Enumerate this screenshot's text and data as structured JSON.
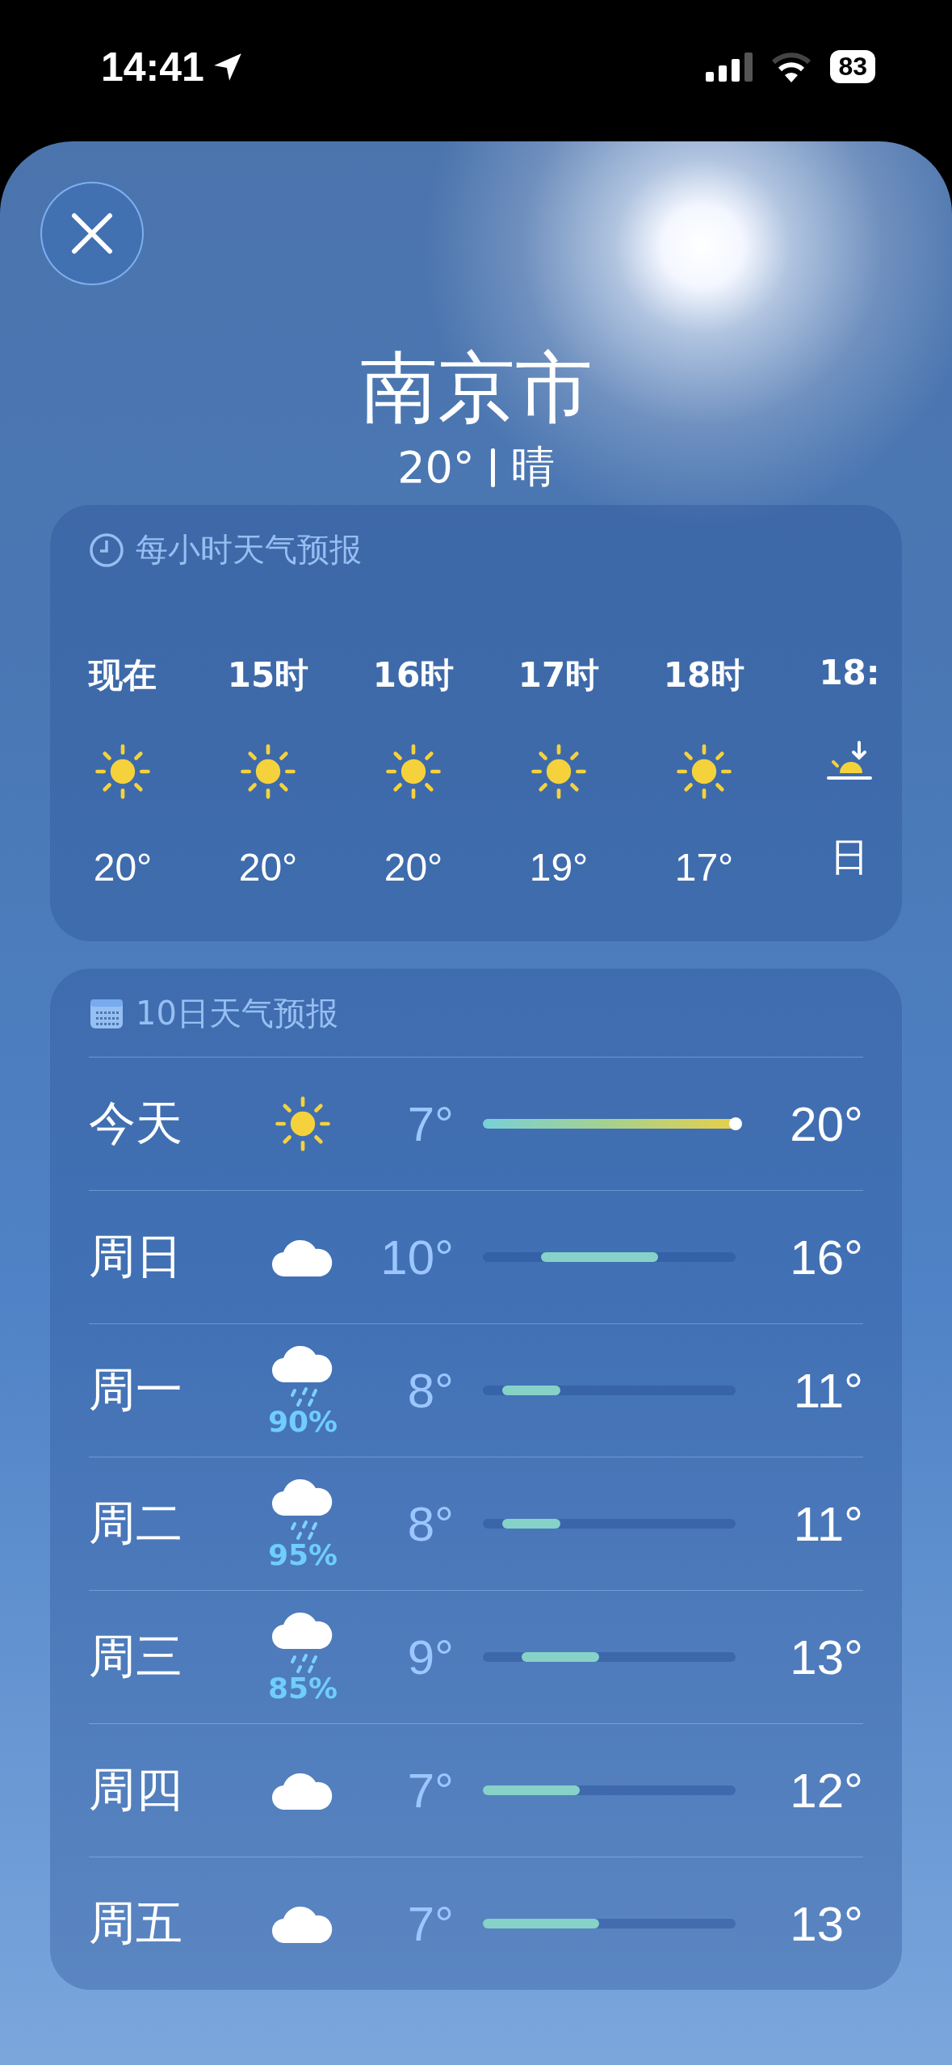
{
  "status_bar": {
    "time": "14:41",
    "battery": "83"
  },
  "header": {
    "city": "南京市",
    "temperature": "20°",
    "condition": "晴"
  },
  "hourly": {
    "title": "每小时天气预报",
    "items": [
      {
        "time": "现在",
        "kind": "sun",
        "temp": "20°"
      },
      {
        "time": "15时",
        "kind": "sun",
        "temp": "20°"
      },
      {
        "time": "16时",
        "kind": "sun",
        "temp": "20°"
      },
      {
        "time": "17时",
        "kind": "sun",
        "temp": "19°"
      },
      {
        "time": "18时",
        "kind": "sun",
        "temp": "17°"
      },
      {
        "time": "18:",
        "kind": "sunset",
        "temp": "日"
      }
    ]
  },
  "daily": {
    "title": "10日天气预报",
    "rows": [
      {
        "day": "今天",
        "kind": "sun",
        "low": "7°",
        "high": "20°",
        "current_marker": true
      },
      {
        "day": "周日",
        "kind": "cloud",
        "low": "10°",
        "high": "16°",
        "current_marker": false
      },
      {
        "day": "周一",
        "kind": "rain",
        "precip": "90%",
        "low": "8°",
        "high": "11°",
        "current_marker": false
      },
      {
        "day": "周二",
        "kind": "rain",
        "precip": "95%",
        "low": "8°",
        "high": "11°",
        "current_marker": false
      },
      {
        "day": "周三",
        "kind": "rain",
        "precip": "85%",
        "low": "9°",
        "high": "13°",
        "current_marker": false
      },
      {
        "day": "周四",
        "kind": "cloud",
        "low": "7°",
        "high": "12°",
        "current_marker": false
      },
      {
        "day": "周五",
        "kind": "cloud",
        "low": "7°",
        "high": "13°",
        "current_marker": false
      }
    ]
  }
}
